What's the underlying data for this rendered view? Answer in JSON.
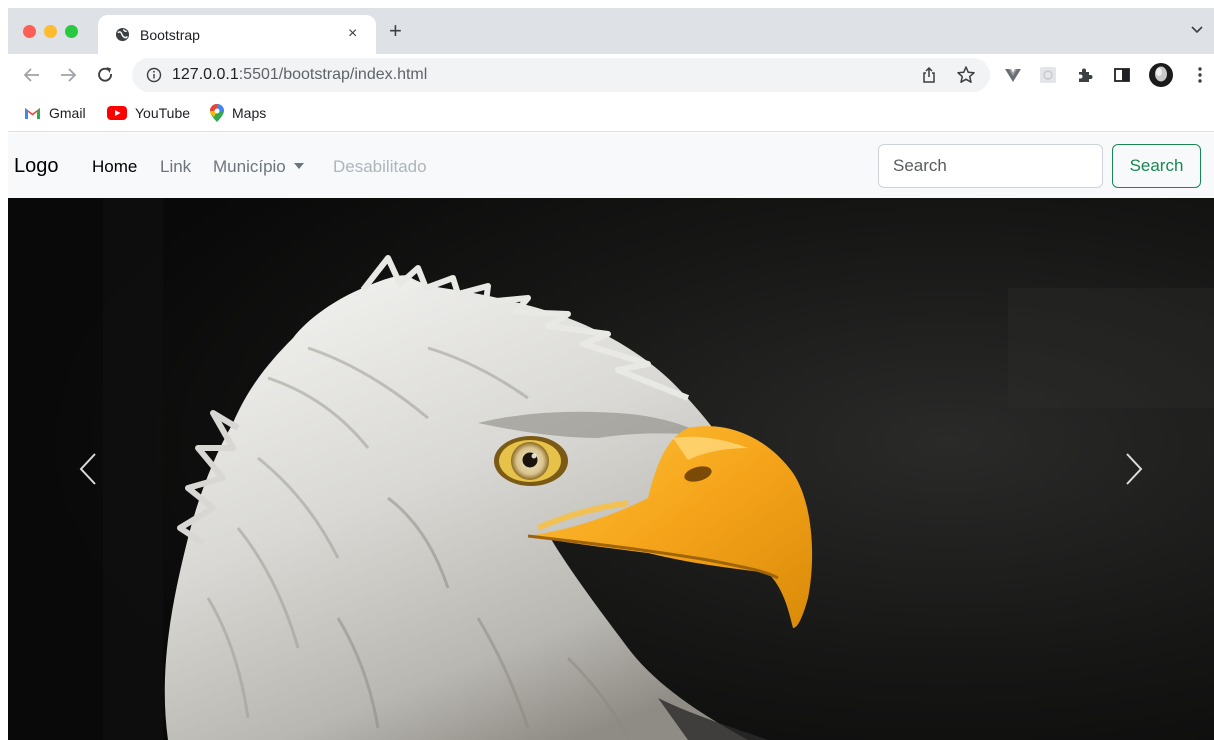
{
  "browser": {
    "tab": {
      "title": "Bootstrap",
      "close": "×"
    },
    "new_tab": "+",
    "address": {
      "host": "127.0.0.1",
      "rest": ":5501/bootstrap/index.html"
    },
    "bookmarks": [
      {
        "label": "Gmail",
        "icon": "gmail-icon"
      },
      {
        "label": "YouTube",
        "icon": "youtube-icon"
      },
      {
        "label": "Maps",
        "icon": "maps-icon"
      }
    ]
  },
  "navbar": {
    "brand": "Logo",
    "links": [
      {
        "label": "Home",
        "state": "active"
      },
      {
        "label": "Link",
        "state": "normal"
      },
      {
        "label": "Município",
        "state": "dropdown"
      },
      {
        "label": "Desabilitado",
        "state": "disabled"
      }
    ],
    "search": {
      "placeholder": "Search",
      "button": "Search"
    }
  },
  "colors": {
    "success": "#198754",
    "navbar_bg": "#f8f9fa",
    "link_muted": "#6c757d",
    "link_disabled": "#adb5bd"
  },
  "carousel": {
    "image": "bald-eagle-head",
    "controls": [
      "carousel-prev-icon",
      "carousel-next-icon"
    ]
  }
}
